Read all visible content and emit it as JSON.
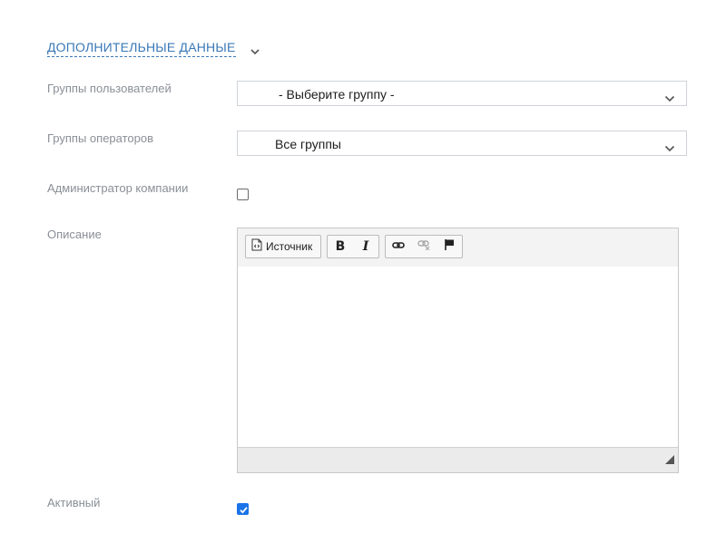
{
  "section": {
    "title": "ДОПОЛНИТЕЛЬНЫЕ ДАННЫЕ",
    "chevron_icon": "chevron-down-icon"
  },
  "fields": {
    "user_groups": {
      "label": "Группы пользователей",
      "value": "- Выберите группу -"
    },
    "operator_groups": {
      "label": "Группы операторов",
      "value": "Все группы"
    },
    "company_admin": {
      "label": "Администратор компании",
      "checked": false
    },
    "description": {
      "label": "Описание",
      "content": ""
    },
    "active": {
      "label": "Активный",
      "checked": true
    }
  },
  "editor": {
    "toolbar": {
      "source_label": "Источник",
      "source_icon": "source-icon",
      "bold_label": "B",
      "italic_label": "I",
      "link_icon": "link-icon",
      "unlink_icon": "unlink-icon",
      "anchor_icon": "flag-icon"
    }
  },
  "colors": {
    "accent": "#3a78b6",
    "label": "#8a8f96",
    "checkbox_checked": "#1a73e8"
  }
}
